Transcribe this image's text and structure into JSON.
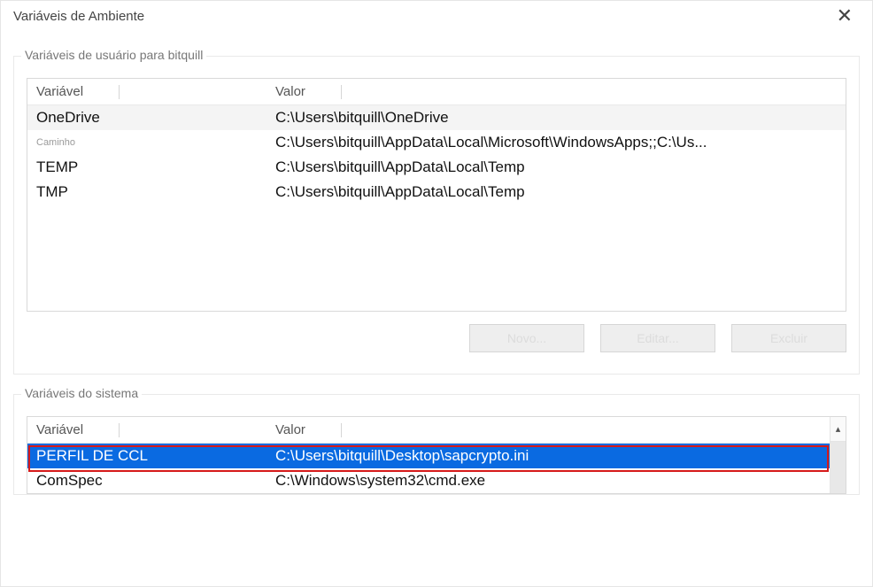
{
  "window": {
    "title": "Variáveis de Ambiente"
  },
  "userVars": {
    "legend": "Variáveis de usuário para bitquill",
    "headers": {
      "var": "Variável",
      "val": "Valor"
    },
    "rows": [
      {
        "var": "OneDrive",
        "val": "C:\\Users\\bitquill\\OneDrive",
        "selected": true
      },
      {
        "var": "Caminho",
        "val": "C:\\Users\\bitquill\\AppData\\Local\\Microsoft\\WindowsApps;;C:\\Us...",
        "smallGray": true
      },
      {
        "var": "TEMP",
        "val": "C:\\Users\\bitquill\\AppData\\Local\\Temp"
      },
      {
        "var": "TMP",
        "val": "C:\\Users\\bitquill\\AppData\\Local\\Temp"
      }
    ]
  },
  "buttons": {
    "new": "Novo...",
    "edit": "Editar...",
    "delete": "Excluir"
  },
  "sysVars": {
    "legend": "Variáveis do sistema",
    "headers": {
      "var": "Variável",
      "val": "Valor"
    },
    "rows": [
      {
        "var": "PERFIL DE CCL",
        "val": "C:\\Users\\bitquill\\Desktop\\sapcrypto.ini",
        "highlighted": true
      },
      {
        "var": "ComSpec",
        "val": "C:\\Windows\\system32\\cmd.exe"
      }
    ]
  }
}
